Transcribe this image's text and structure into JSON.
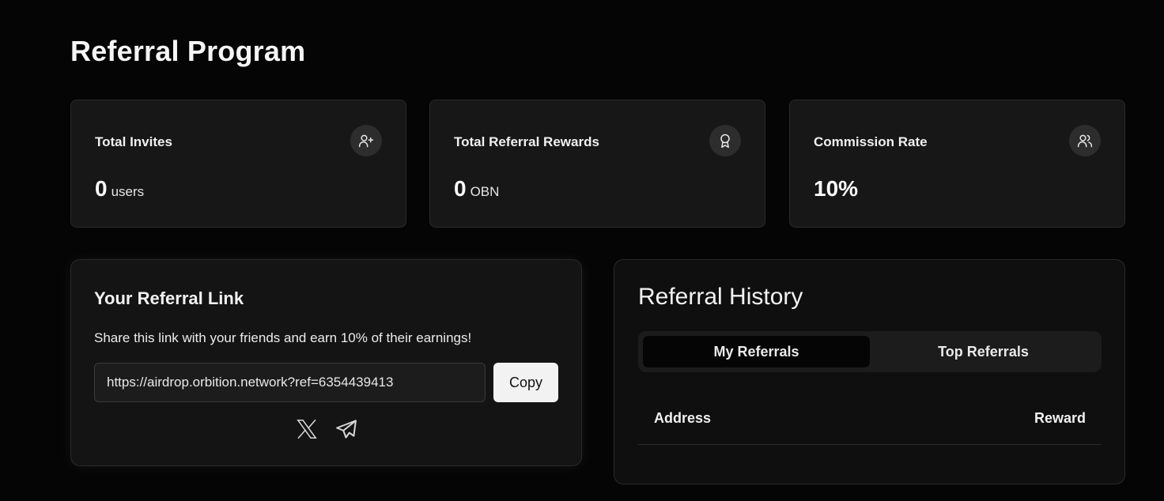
{
  "page": {
    "title": "Referral Program"
  },
  "stats": [
    {
      "label": "Total Invites",
      "value": "0",
      "unit": "users",
      "icon": "user-plus-icon"
    },
    {
      "label": "Total Referral Rewards",
      "value": "0",
      "unit": "OBN",
      "icon": "award-icon"
    },
    {
      "label": "Commission Rate",
      "value": "10%",
      "unit": "",
      "icon": "users-icon"
    }
  ],
  "referral_link": {
    "title": "Your Referral Link",
    "description": "Share this link with your friends and earn 10% of their earnings!",
    "url": "https://airdrop.orbition.network?ref=6354439413",
    "copy_label": "Copy",
    "share_icons": [
      "x-twitter-icon",
      "telegram-icon"
    ]
  },
  "history": {
    "title": "Referral History",
    "tabs": [
      {
        "label": "My Referrals",
        "active": true
      },
      {
        "label": "Top Referrals",
        "active": false
      }
    ],
    "columns": [
      "Address",
      "Reward"
    ]
  },
  "colors": {
    "background": "#050505",
    "card": "#171717",
    "button": "#f2f2f2"
  }
}
